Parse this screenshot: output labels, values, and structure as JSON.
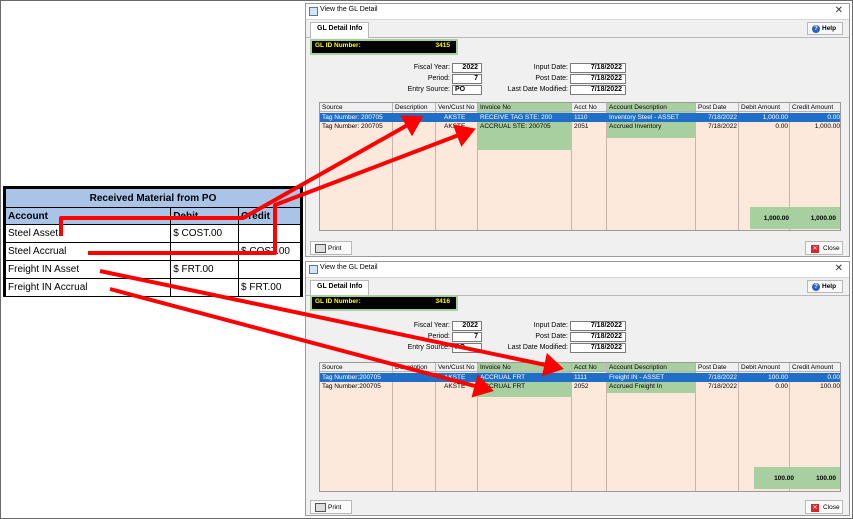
{
  "journal_table": {
    "title": "Received Material from PO",
    "headers": [
      "Account",
      "Debit",
      "Credit"
    ],
    "rows": [
      {
        "account": "Steel Asset",
        "debit": "$ COST.00",
        "credit": ""
      },
      {
        "account": "Steel Accrual",
        "debit": "",
        "credit": "$ COST.00"
      },
      {
        "account": "Freight IN Asset",
        "debit": "$ FRT.00",
        "credit": ""
      },
      {
        "account": "Freight IN Accrual",
        "debit": "",
        "credit": "$ FRT.00"
      }
    ]
  },
  "windows": [
    {
      "title": "View the GL Detail",
      "tab": "GL Detail Info",
      "help_label": "Help",
      "gl_id_label": "GL ID Number:",
      "gl_id": "3415",
      "fiscal_year_label": "Fiscal Year:",
      "fiscal_year": "2022",
      "period_label": "Period:",
      "period": "7",
      "entry_source_label": "Entry Source:",
      "entry_source": "PO",
      "input_date_label": "Input Date:",
      "input_date": "7/18/2022",
      "post_date_label": "Post Date:",
      "post_date": "7/18/2022",
      "last_modified_label": "Last Date Modified:",
      "last_modified": "7/18/2022",
      "columns": [
        "Source",
        "Description",
        "Ven/Cust No",
        "Invoice No",
        "Acct No",
        "Account Description",
        "Post Date",
        "Debit Amount",
        "Credit Amount"
      ],
      "rows": [
        {
          "source": "Tag Number: 200705",
          "description": "",
          "vencust": "AKSTE",
          "invoice": "RECEIVE TAG STE: 200",
          "acct": "1110",
          "acct_desc": "Inventory Steel - ASSET",
          "post_date": "7/18/2022",
          "debit": "1,000.00",
          "credit": "0.00"
        },
        {
          "source": "Tag Number: 200705",
          "description": "",
          "vencust": "AKSTE",
          "invoice": "ACCRUAL STE: 200705",
          "acct": "2051",
          "acct_desc": "Accrued Inventory",
          "post_date": "7/18/2022",
          "debit": "0.00",
          "credit": "1,000.00"
        }
      ],
      "total_debit": "1,000.00",
      "total_credit": "1,000.00",
      "print_label": "Print",
      "close_label": "Close"
    },
    {
      "title": "View the GL Detail",
      "tab": "GL Detail Info",
      "help_label": "Help",
      "gl_id_label": "GL ID Number:",
      "gl_id": "3416",
      "fiscal_year_label": "Fiscal Year:",
      "fiscal_year": "2022",
      "period_label": "Period:",
      "period": "7",
      "entry_source_label": "Entry Source:",
      "entry_source": "PO",
      "input_date_label": "Input Date:",
      "input_date": "7/18/2022",
      "post_date_label": "Post Date:",
      "post_date": "7/18/2022",
      "last_modified_label": "Last Date Modified:",
      "last_modified": "7/18/2022",
      "columns": [
        "Source",
        "Description",
        "Ven/Cust No",
        "Invoice No",
        "Acct No",
        "Account Description",
        "Post Date",
        "Debit Amount",
        "Credit Amount"
      ],
      "rows": [
        {
          "source": "Tag Number:200705",
          "description": "",
          "vencust": "AKSTE",
          "invoice": "ACCRUAL FRT",
          "acct": "1111",
          "acct_desc": "Freight IN - ASSET",
          "post_date": "7/18/2022",
          "debit": "100.00",
          "credit": "0.00"
        },
        {
          "source": "Tag Number:200705",
          "description": "",
          "vencust": "AKSTE",
          "invoice": "ACCRUAL FRT",
          "acct": "2052",
          "acct_desc": "Accrued Freight In",
          "post_date": "7/18/2022",
          "debit": "0.00",
          "credit": "100.00"
        }
      ],
      "total_debit": "100.00",
      "total_credit": "100.00",
      "print_label": "Print",
      "close_label": "Close"
    }
  ],
  "colors": {
    "highlight_green": "#a8cfa0",
    "selected_row": "#1f6fc9",
    "grid_bg": "#fde8dc",
    "arrow_red": "#ff0000",
    "table_header": "#a9c4e7",
    "gl_id_text": "#ffff00"
  }
}
